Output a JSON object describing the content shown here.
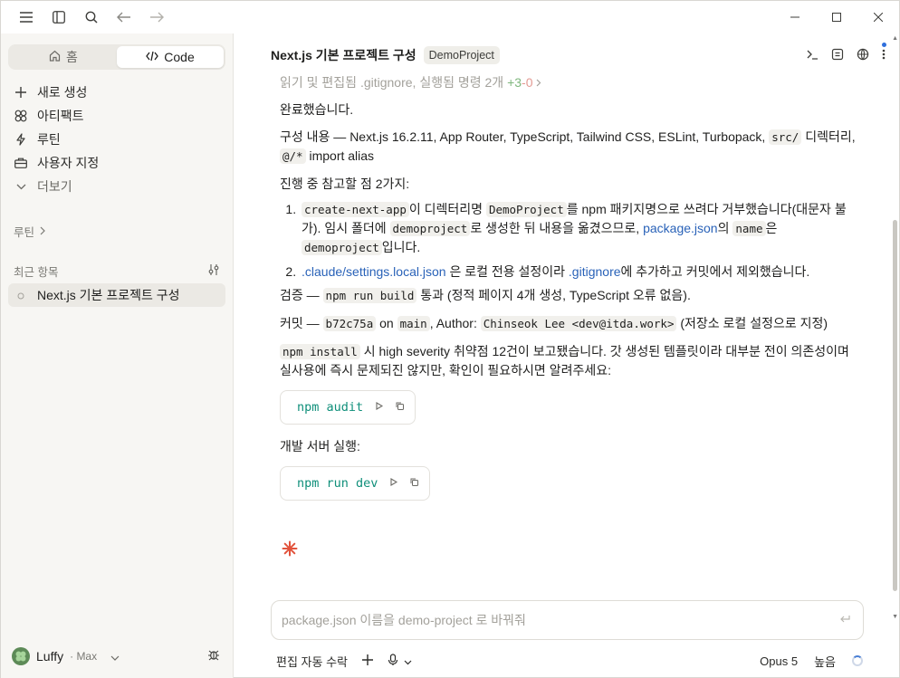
{
  "sidebar": {
    "home_label": "홈",
    "code_label": "Code",
    "nav": [
      {
        "label": "새로 생성",
        "icon": "plus-icon"
      },
      {
        "label": "아티팩트",
        "icon": "artifacts-icon"
      },
      {
        "label": "루틴",
        "icon": "routine-icon"
      },
      {
        "label": "사용자 지정",
        "icon": "briefcase-icon"
      },
      {
        "label": "더보기",
        "icon": "chevron-down-icon"
      }
    ],
    "routines_label": "루틴",
    "recent_label": "최근 항목",
    "recent_item": "Next.js 기본 프로젝트 구성",
    "user_name": "Luffy",
    "user_plan": "· Max"
  },
  "header": {
    "title": "Next.js 기본 프로젝트 구성",
    "project": "DemoProject"
  },
  "message": {
    "summary": "읽기 및 편집됨 .gitignore, 실행됨 명령 2개",
    "summary_added": "+3",
    "summary_removed": "-0",
    "done": "완료했습니다.",
    "config_prefix": "구성 내용 — Next.js 16.2.11, App Router, TypeScript, Tailwind CSS, ESLint, Turbopack,",
    "config_code1": "src/",
    "config_mid": "디렉터리,",
    "config_code2": "@/*",
    "config_suffix": "import alias",
    "notes_intro": "진행 중 참고할 점 2가지:",
    "note1_code1": "create-next-app",
    "note1_t1": "이 디렉터리명",
    "note1_code2": "DemoProject",
    "note1_t2": "를 npm 패키지명으로 쓰려다 거부했습니다(대문자 불가). 임시 폴더에",
    "note1_code3": "demoproject",
    "note1_t3": "로 생성한 뒤 내용을 옮겼으므로,",
    "note1_link": "package.json",
    "note1_t4": "의",
    "note1_code4": "name",
    "note1_t5": "은",
    "note1_code5": "demoproject",
    "note1_t6": "입니다.",
    "note2_link1": ".claude/settings.local.json",
    "note2_t1": "은 로컬 전용 설정이라",
    "note2_link2": ".gitignore",
    "note2_t2": "에 추가하고 커밋에서 제외했습니다.",
    "verify_prefix": "검증 —",
    "verify_code": "npm run build",
    "verify_suffix": "통과 (정적 페이지 4개 생성, TypeScript 오류 없음).",
    "commit_prefix": "커밋 —",
    "commit_hash": "b72c75a",
    "commit_on": "on",
    "commit_branch": "main",
    "commit_author_label": ", Author:",
    "commit_author": "Chinseok Lee <dev@itda.work>",
    "commit_suffix": "(저장소 로컬 설정으로 지정)",
    "audit_code": "npm install",
    "audit_text": "시 high severity 취약점 12건이 보고됐습니다. 갓 생성된 템플릿이라 대부분 전이 의존성이며 실사용에 즉시 문제되진 않지만, 확인이 필요하시면 알려주세요:",
    "cmd1": "npm audit",
    "dev_label": "개발 서버 실행:",
    "cmd2": "npm run dev"
  },
  "composer": {
    "placeholder": "package.json 이름을 demo-project 로 바꿔줘"
  },
  "bottom": {
    "auto_accept": "편집 자동 수락",
    "model": "Opus 5",
    "effort": "높음"
  },
  "colors": {
    "accent_link": "#2962b8",
    "code_cmd": "#0f8f7a",
    "spark": "#e2533c"
  }
}
